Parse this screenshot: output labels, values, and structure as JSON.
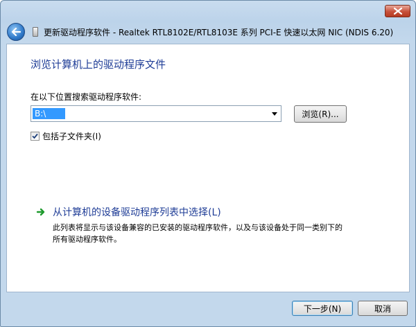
{
  "window": {
    "title": "更新驱动程序软件 - Realtek RTL8102E/RTL8103E 系列 PCI-E 快速以太网 NIC (NDIS 6.20)"
  },
  "main": {
    "heading": "浏览计算机上的驱动程序文件",
    "search_label": "在以下位置搜索驱动程序软件:",
    "path_value": "B:\\",
    "browse_label": "浏览(R)...",
    "include_subfolders_label": "包括子文件夹(I)",
    "include_subfolders_checked": true,
    "pick_title": "从计算机的设备驱动程序列表中选择(L)",
    "pick_desc_line1": "此列表将显示与该设备兼容的已安装的驱动程序软件，以及与该设备处于同一类别下的",
    "pick_desc_line2": "所有驱动程序软件。"
  },
  "footer": {
    "next_label": "下一步(N)",
    "cancel_label": "取消"
  },
  "icons": {
    "close": "close-icon",
    "back": "back-arrow-icon",
    "app": "device-icon",
    "dropdown": "chevron-down-icon",
    "check": "checkmark-icon",
    "link_arrow": "green-arrow-icon"
  }
}
